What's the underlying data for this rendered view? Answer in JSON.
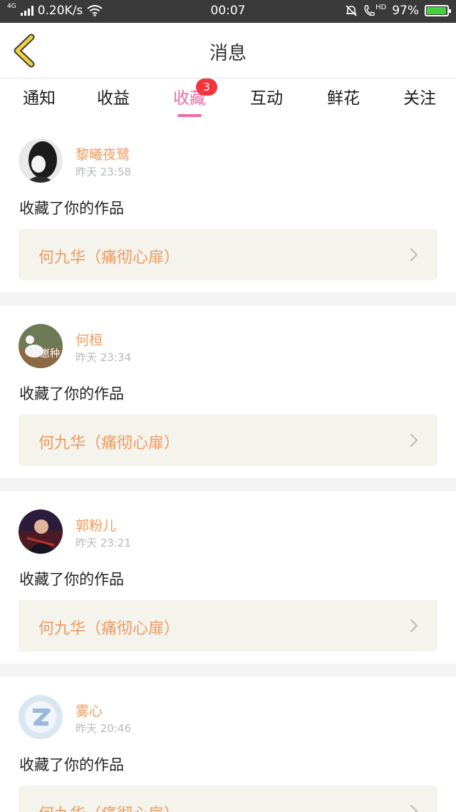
{
  "status_bar": {
    "network_type": "4G",
    "speed": "0.20K/s",
    "time": "00:07",
    "hd": "HD",
    "battery": "97%",
    "battery_level": 0.97
  },
  "header": {
    "title": "消息"
  },
  "tabs": [
    {
      "label": "通知"
    },
    {
      "label": "收益"
    },
    {
      "label": "收藏",
      "badge": "3"
    },
    {
      "label": "互动"
    },
    {
      "label": "鲜花"
    },
    {
      "label": "关注"
    }
  ],
  "active_tab_index": 2,
  "items": [
    {
      "name": "黎曦夜鹭",
      "time": "昨天 23:58",
      "action": "收藏了你的作品",
      "work": "何九华（痛彻心扉）"
    },
    {
      "name": "何桓",
      "time": "昨天 23:34",
      "action": "收藏了你的作品",
      "work": "何九华（痛彻心扉）",
      "avatar_text": "崽种"
    },
    {
      "name": "郭粉儿",
      "time": "昨天 23:21",
      "action": "收藏了你的作品",
      "work": "何九华（痛彻心扉）"
    },
    {
      "name": "雾心",
      "time": "昨天 20:46",
      "action": "收藏了你的作品",
      "work": "何九华（痛彻心扉）"
    }
  ],
  "colors": {
    "accent_pink": "#f06aa6",
    "orange_text": "#ef9a60",
    "badge_red": "#f0353d",
    "back_arrow_yellow": "#f2d33c",
    "work_box_bg": "#f4f3ec"
  }
}
